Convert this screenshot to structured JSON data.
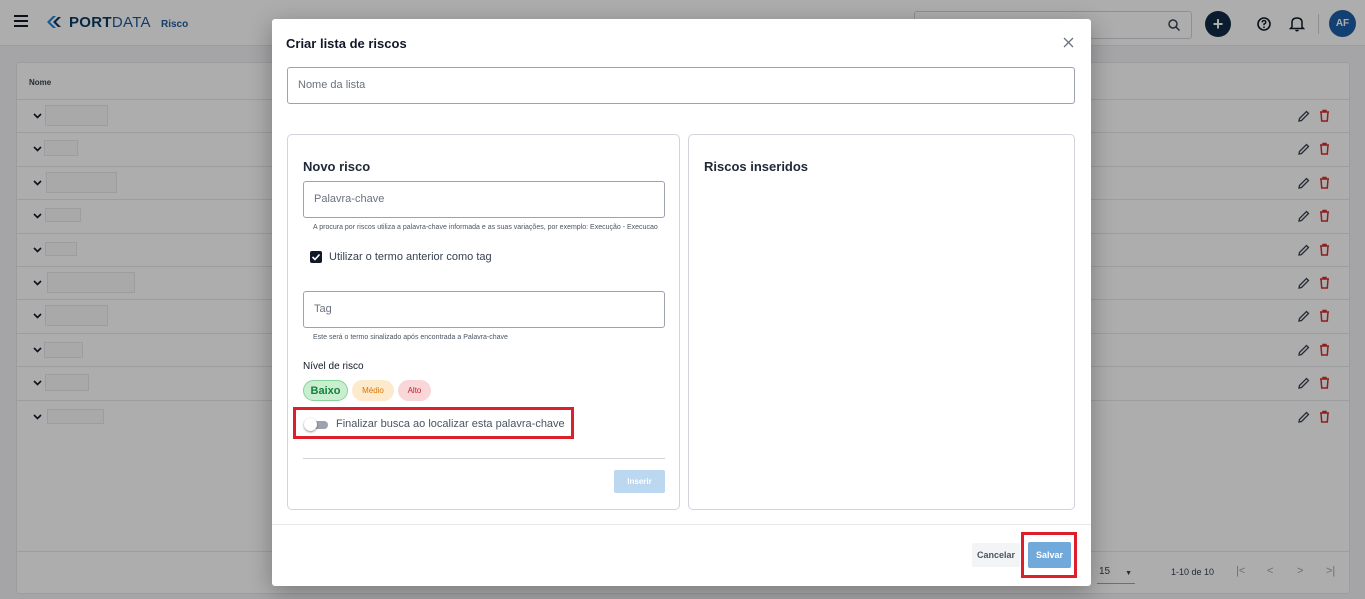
{
  "app": {
    "brand_bold": "PORT",
    "brand_light": "DATA",
    "module": "Risco",
    "user_initials": "AF"
  },
  "table": {
    "column_name": "Nome",
    "rows": 10,
    "page_size": "15",
    "range": "1-10 de 10"
  },
  "modal": {
    "title": "Criar lista de riscos",
    "list_name_placeholder": "Nome da lista",
    "new_risk": {
      "title": "Novo risco",
      "keyword_placeholder": "Palavra-chave",
      "keyword_hint": "A procura por riscos utiliza a palavra-chave informada e as suas variações, por exemplo: Execução - Execucao",
      "use_as_tag_label": "Utilizar o termo anterior como tag",
      "use_as_tag_checked": true,
      "tag_placeholder": "Tag",
      "tag_hint": "Este será o termo sinalizado após encontrada a Palavra-chave",
      "level_label": "Nível de risco",
      "levels": {
        "low": "Baixo",
        "medium": "Médio",
        "high": "Alto"
      },
      "selected_level": "Baixo",
      "finish_search_label": "Finalizar busca ao localizar esta palavra-chave",
      "finish_search_enabled": false,
      "insert_button": "Inserir"
    },
    "inserted": {
      "title": "Riscos inseridos"
    },
    "cancel_button": "Cancelar",
    "save_button": "Salvar"
  },
  "colors": {
    "highlight": "#dc1f2a",
    "primary": "#72a9db",
    "brand": "#0b3a66"
  }
}
